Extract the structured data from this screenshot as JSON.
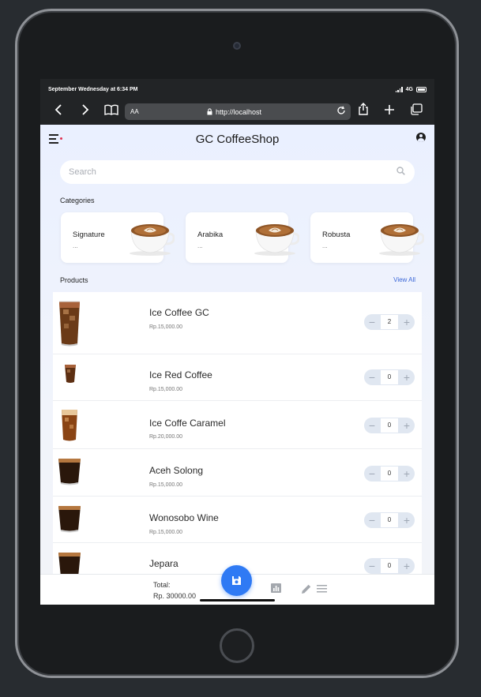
{
  "status_bar": {
    "date_time": "September Wednesday at 6:34 PM",
    "network": "4G"
  },
  "browser": {
    "text_size_label": "AA",
    "url": "http://localhost",
    "icons": [
      "chevron-left-icon",
      "chevron-right-icon",
      "book-icon",
      "lock-icon",
      "reload-icon",
      "share-icon",
      "plus-icon",
      "tabs-icon"
    ]
  },
  "app": {
    "title": "GC CoffeeShop",
    "search": {
      "placeholder": "Search",
      "value": ""
    },
    "categories_label": "Categories",
    "categories": [
      {
        "name": "Signature",
        "sub": "..."
      },
      {
        "name": "Arabika",
        "sub": "..."
      },
      {
        "name": "Robusta",
        "sub": "..."
      }
    ],
    "products_label": "Products",
    "view_all": "View All",
    "products": [
      {
        "name": "Ice Coffee GC",
        "price": "Rp.15,000.00",
        "qty": "2"
      },
      {
        "name": "Ice Red Coffee",
        "price": "Rp.15,000.00",
        "qty": "0"
      },
      {
        "name": "Ice Coffe Caramel",
        "price": "Rp.20,000.00",
        "qty": "0"
      },
      {
        "name": "Aceh Solong",
        "price": "Rp.15,000.00",
        "qty": "0"
      },
      {
        "name": "Wonosobo Wine",
        "price": "Rp.15,000.00",
        "qty": "0"
      },
      {
        "name": "Jepara",
        "price": "",
        "qty": "0"
      }
    ],
    "bottom": {
      "total_label": "Total:",
      "total_value": "Rp. 30000.00"
    }
  },
  "colors": {
    "accent": "#2f7af4",
    "link": "#3b67d8",
    "badge_dot": "#e03050",
    "app_bg": "#eaf0ff"
  }
}
